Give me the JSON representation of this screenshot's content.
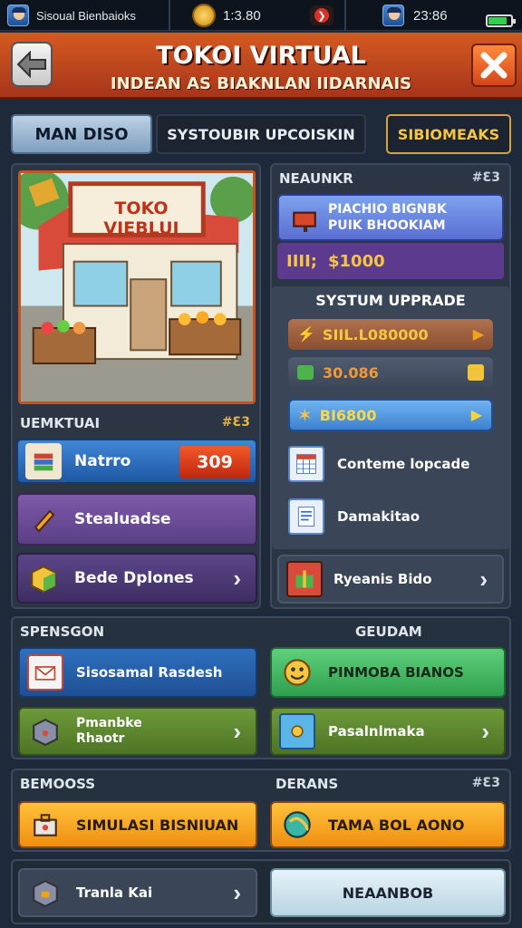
{
  "status_bar": {
    "left_label": "Sisoual Bienbaioks",
    "center_value": "1:3.80",
    "right_value": "23:86"
  },
  "header": {
    "title": "TOKOI VIRTUAL",
    "subtitle": "INDEAN AS BIAKNLAN IIDARNAIS"
  },
  "tabs": [
    {
      "label": "MAN DISO"
    },
    {
      "label": "SYSTOUBIR UPCOISKIN"
    },
    {
      "label": "SIBIOMEAKS"
    }
  ],
  "left": {
    "shop_sign": "TOKO VIEBLUI",
    "section_label": "UEMKTUAI",
    "section_count": "#Ɛ3",
    "items": [
      {
        "label": "Natrro",
        "value": "309"
      },
      {
        "label": "Stealuadse"
      },
      {
        "label": "Bede Dplones"
      }
    ]
  },
  "right": {
    "top_label": "NEAUNKR",
    "top_count": "#Ɛ3",
    "promo": {
      "line1": "PIACHIO BIGNBK",
      "line2": "PUIK BHOOKIAM"
    },
    "price": "$1000",
    "price_prefix": "IIII; ",
    "upgrade_title": "SYSTUM UPPRADE",
    "upgrades": [
      {
        "label": "SIIL.L080000"
      },
      {
        "label": "30.086"
      },
      {
        "label": "BI6800"
      }
    ],
    "items": [
      {
        "label": "Conteme lopcade"
      },
      {
        "label": "Damakitao"
      },
      {
        "label": "Ryeanis Bido"
      }
    ]
  },
  "section2": {
    "left_label": "SPENSGON",
    "right_label": "GEUDAM",
    "buttons": [
      {
        "label": "Sisosamal Rasdesh"
      },
      {
        "label": "PINMOBA BIANOS"
      },
      {
        "label": "Pmanbke\nRhaotr"
      },
      {
        "label": "Pasalnlmaka"
      }
    ]
  },
  "section3": {
    "left_label": "BEMOOSS",
    "right_label": "DERANS",
    "right_count": "#Ɛ3",
    "buttons": [
      {
        "label": "SIMULASI BISNIUAN"
      },
      {
        "label": "TAMA BOL AONO"
      }
    ]
  },
  "footer": {
    "left_label": "Tranla Kai",
    "right_label": "NEAANBOB"
  },
  "colors": {
    "header_red": "#c44a1f",
    "accent_gold": "#f7c640",
    "blue_btn": "#2e6fbf",
    "green_btn": "#3fbf62",
    "orange_btn": "#f2a21b"
  }
}
